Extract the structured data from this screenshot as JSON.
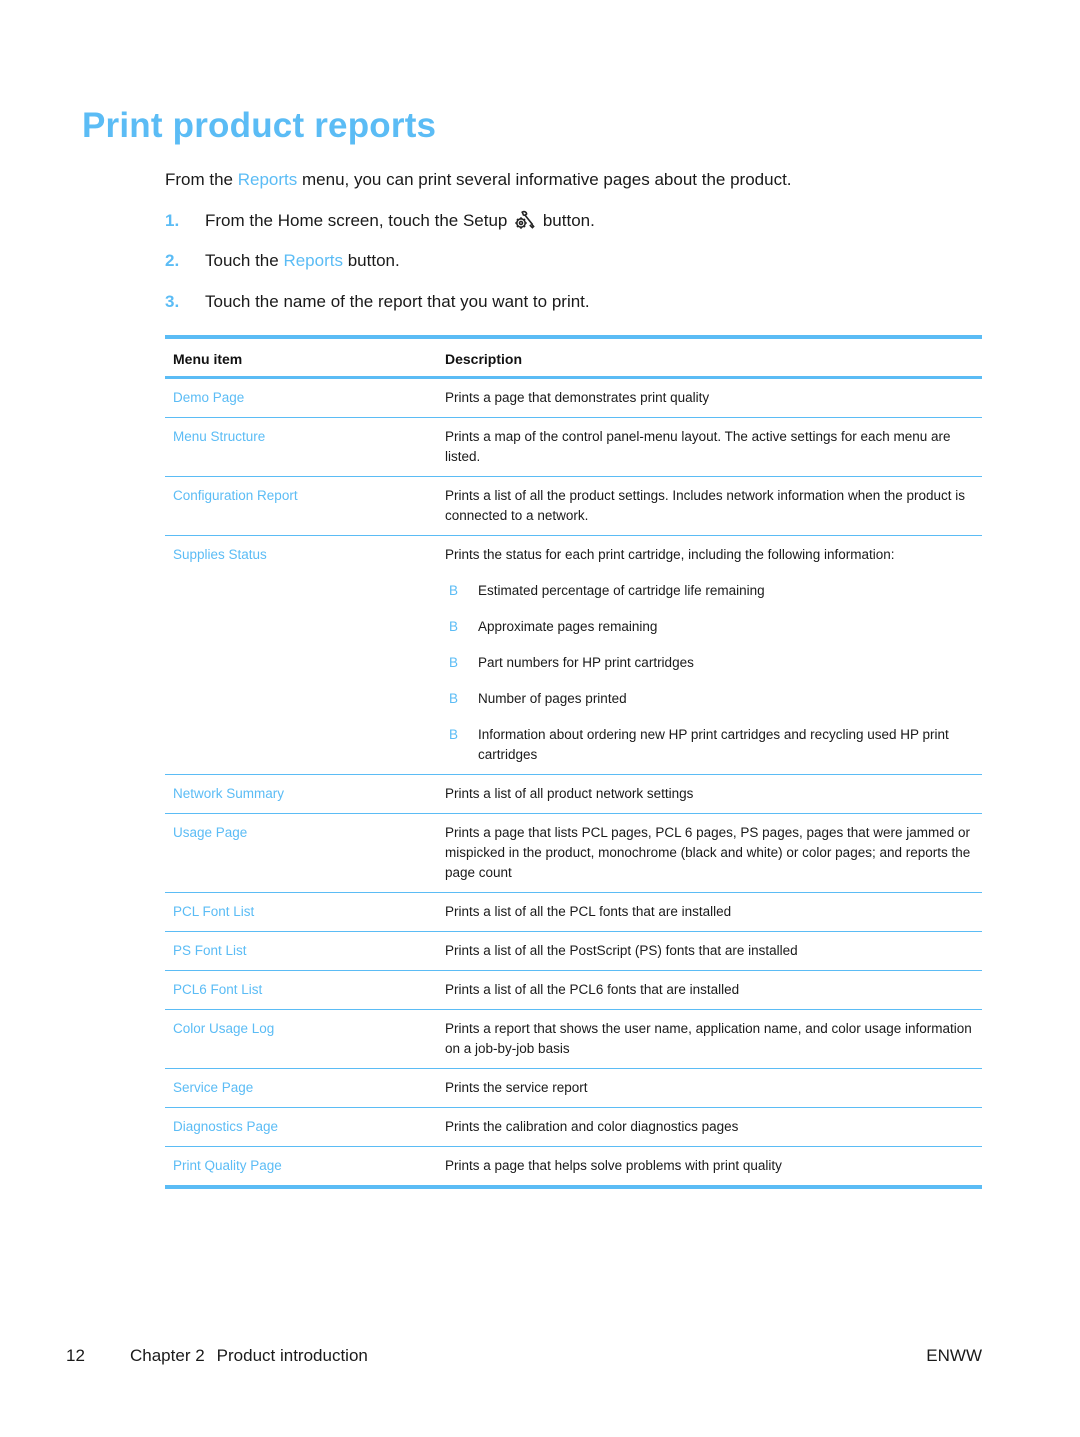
{
  "page": {
    "title": "Print product reports",
    "accent_color": "#5bbcf5"
  },
  "intro": {
    "before": "From the ",
    "link": "Reports",
    "after": " menu, you can print several informative pages about the product."
  },
  "steps": [
    {
      "number": "1.",
      "before": "From the Home screen, touch the Setup ",
      "icon": "setup-icon",
      "after": " button."
    },
    {
      "number": "2.",
      "before": "Touch the ",
      "link": "Reports",
      "after": " button."
    },
    {
      "number": "3.",
      "text": "Touch the name of the report that you want to print."
    }
  ],
  "table": {
    "headers": [
      "Menu item",
      "Description"
    ],
    "rows": [
      {
        "item": "Demo Page",
        "description": "Prints a page that demonstrates print quality"
      },
      {
        "item": "Menu Structure",
        "description": "Prints a map of the control panel-menu layout. The active settings for each menu are listed."
      },
      {
        "item": "Configuration Report",
        "description": "Prints a list of all the product settings. Includes network information when the product is connected to a network."
      },
      {
        "item": "Supplies Status",
        "description": "Prints the status for each print cartridge, including the following information:",
        "bullet_marker": "B",
        "bullets": [
          "Estimated percentage of cartridge life remaining",
          "Approximate pages remaining",
          "Part numbers for HP print cartridges",
          "Number of pages printed",
          "Information about ordering new HP print cartridges and recycling used HP print cartridges"
        ]
      },
      {
        "item": "Network Summary",
        "description": "Prints a list of all product network settings"
      },
      {
        "item": "Usage Page",
        "description": "Prints a page that lists PCL pages, PCL 6 pages, PS pages, pages that were jammed or mispicked in the product, monochrome (black and white) or color pages; and reports the page count"
      },
      {
        "item": "PCL Font List",
        "description": "Prints a list of all the PCL fonts that are installed"
      },
      {
        "item": "PS Font List",
        "description": "Prints a list of all the PostScript (PS) fonts that are installed"
      },
      {
        "item": "PCL6 Font List",
        "description": "Prints a list of all the PCL6 fonts that are installed"
      },
      {
        "item": "Color Usage Log",
        "description": "Prints a report that shows the user name, application name, and color usage information on a job-by-job basis"
      },
      {
        "item": "Service Page",
        "description": "Prints the service report"
      },
      {
        "item": "Diagnostics Page",
        "description": "Prints the calibration and color diagnostics pages"
      },
      {
        "item": "Print Quality Page",
        "description": "Prints a page that helps solve problems with print quality"
      }
    ]
  },
  "footer": {
    "page_number": "12",
    "chapter": "Chapter 2",
    "chapter_title": "Product introduction",
    "locale": "ENWW"
  }
}
